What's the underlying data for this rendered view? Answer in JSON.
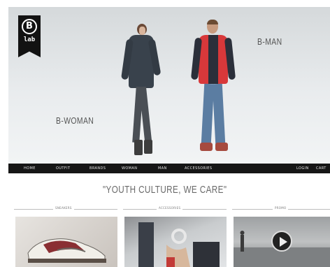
{
  "brand": {
    "logo_letter": "B",
    "logo_text": "lab"
  },
  "hero": {
    "woman_caption": "B-WOMAN",
    "man_caption": "B-MAN"
  },
  "nav": {
    "items": [
      "HOME",
      "OUTFIT",
      "BRANDS",
      "WOMAN",
      "MAN",
      "ACCESSORIES"
    ],
    "right_items": [
      "LOGIN",
      "CART"
    ]
  },
  "tagline": "\"YOUTH CULTURE, WE CARE\"",
  "sections": [
    {
      "label": "SNEAKERS",
      "icon": "sneaker-photo"
    },
    {
      "label": "ACCESSORIES",
      "icon": "accessories-photo"
    },
    {
      "label": "PROMO",
      "icon": "play-icon"
    }
  ],
  "colors": {
    "nav_bg": "#161616",
    "accent_red": "#d8383a",
    "logo_bg": "#121212"
  }
}
